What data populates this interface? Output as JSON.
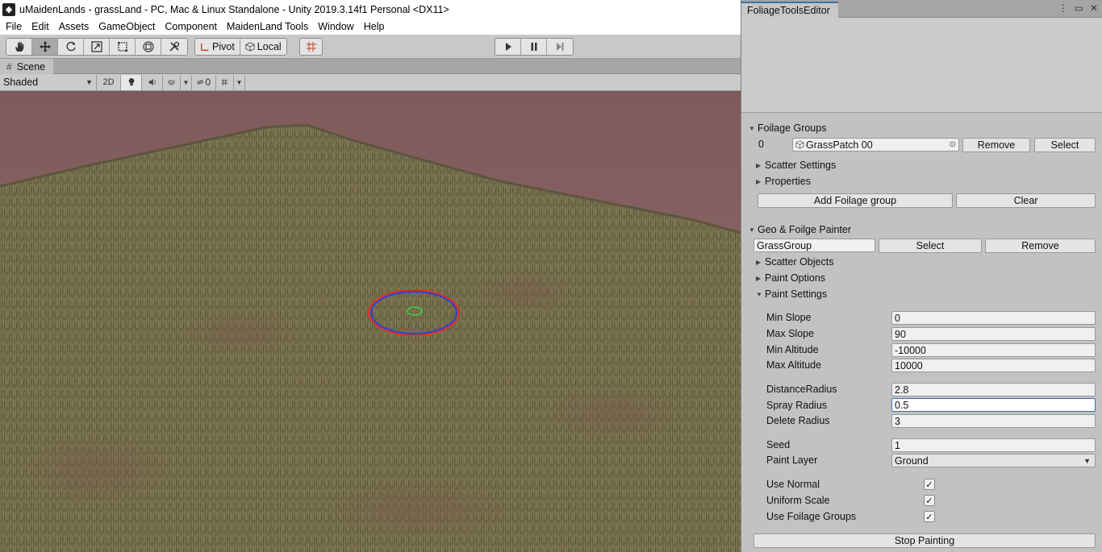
{
  "window": {
    "title": "uMaidenLands - grassLand - PC, Mac & Linux Standalone - Unity 2019.3.14f1 Personal <DX11>",
    "app_icon": "unity-logo-icon"
  },
  "menu": [
    "File",
    "Edit",
    "Assets",
    "GameObject",
    "Component",
    "MaidenLand Tools",
    "Window",
    "Help"
  ],
  "toolbar": {
    "tools": [
      "hand-tool",
      "move-tool",
      "rotate-tool",
      "scale-tool",
      "rect-tool",
      "transform-tool",
      "custom-tool"
    ],
    "active_tool": "move-tool",
    "pivot_label": "Pivot",
    "local_label": "Local",
    "play_controls": [
      "play",
      "pause",
      "step"
    ]
  },
  "scene": {
    "tab_label": "Scene",
    "shading_mode": "Shaded",
    "mode_2d": "2D",
    "hidden_count": "0",
    "colors": {
      "sky": "#8a6566",
      "grass": "#6f6848",
      "brush_outer_red": "#e0302a",
      "brush_outer_blue": "#2f3fd0",
      "brush_inner_green": "#3fd23f"
    }
  },
  "panel": {
    "tab_label": "FoliageToolsEditor",
    "foliage_groups": {
      "header": "Foilage Groups",
      "index": "0",
      "object_name": "GrassPatch 00",
      "remove_label": "Remove",
      "select_label": "Select",
      "scatter_settings": "Scatter Settings",
      "properties": "Properties",
      "add_label": "Add Foilage group",
      "clear_label": "Clear"
    },
    "painter": {
      "header": "Geo & Foilge Painter",
      "group_name": "GrassGroup",
      "select_label": "Select",
      "remove_label": "Remove",
      "scatter_objects": "Scatter Objects",
      "paint_options": "Paint Options",
      "paint_settings": "Paint Settings",
      "fields": {
        "min_slope": {
          "label": "Min Slope",
          "value": "0"
        },
        "max_slope": {
          "label": "Max Slope",
          "value": "90"
        },
        "min_altitude": {
          "label": "Min Altitude",
          "value": "-10000"
        },
        "max_altitude": {
          "label": "Max Altitude",
          "value": "10000"
        },
        "distance_radius": {
          "label": "DistanceRadius",
          "value": "2.8"
        },
        "spray_radius": {
          "label": "Spray Radius",
          "value": "0.5"
        },
        "delete_radius": {
          "label": "Delete Radius",
          "value": "3"
        },
        "seed": {
          "label": "Seed",
          "value": "1"
        },
        "paint_layer": {
          "label": "Paint Layer",
          "value": "Ground"
        }
      },
      "toggles": {
        "use_normal": {
          "label": "Use Normal",
          "checked": true
        },
        "uniform_scale": {
          "label": "Uniform Scale",
          "checked": true
        },
        "use_foilage_groups": {
          "label": "Use Foilage Groups",
          "checked": true
        }
      },
      "stop_label": "Stop Painting"
    }
  }
}
